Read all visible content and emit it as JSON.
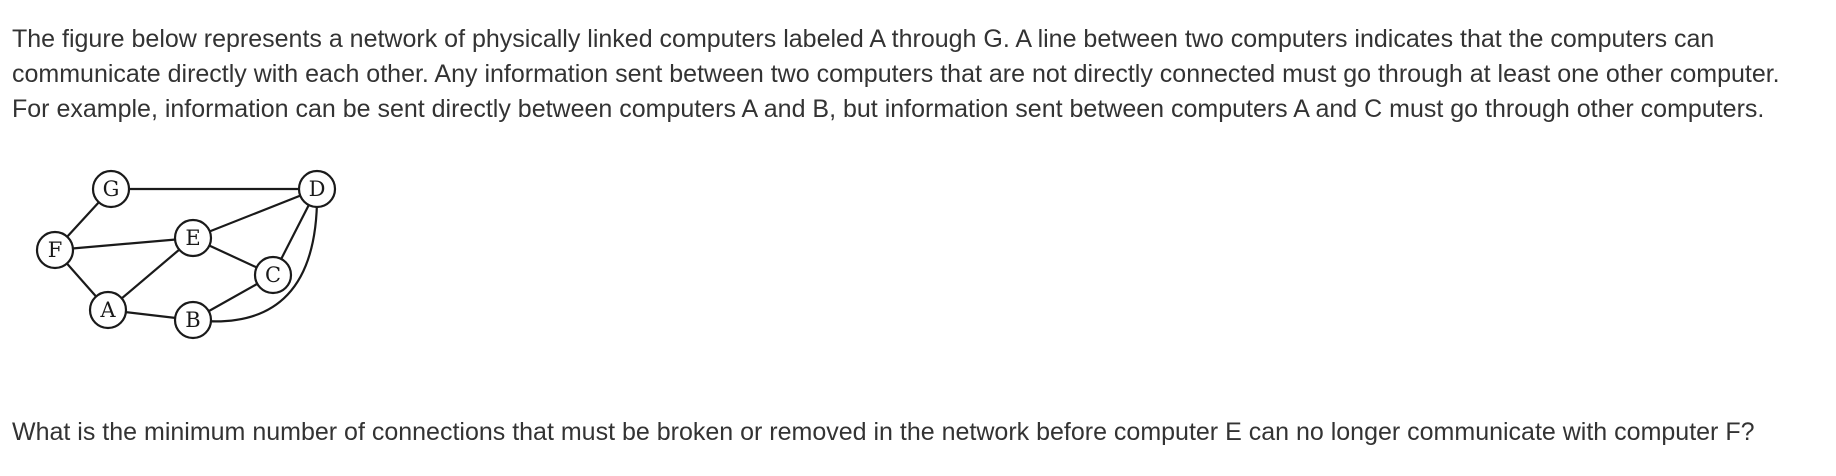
{
  "intro": {
    "lines": [
      "The figure below represents a network of physically linked computers labeled A through G. A line between two computers indicates that the computers can",
      "communicate directly with each other. Any information sent between two computers that are not directly connected must go through at least one other computer.",
      "For example, information can be sent directly between computers A and B, but information sent between computers A and C must go through other computers."
    ]
  },
  "diagram": {
    "nodes": [
      "G",
      "D",
      "F",
      "E",
      "C",
      "A",
      "B"
    ],
    "edges": [
      [
        "G",
        "D"
      ],
      [
        "G",
        "F"
      ],
      [
        "F",
        "E"
      ],
      [
        "F",
        "A"
      ],
      [
        "A",
        "E"
      ],
      [
        "A",
        "B"
      ],
      [
        "E",
        "D"
      ],
      [
        "E",
        "C"
      ],
      [
        "C",
        "D"
      ],
      [
        "C",
        "B"
      ],
      [
        "B",
        "D"
      ]
    ]
  },
  "question": "What is the minimum number of connections that must be broken or removed in the network before computer E can no longer communicate with computer F?"
}
